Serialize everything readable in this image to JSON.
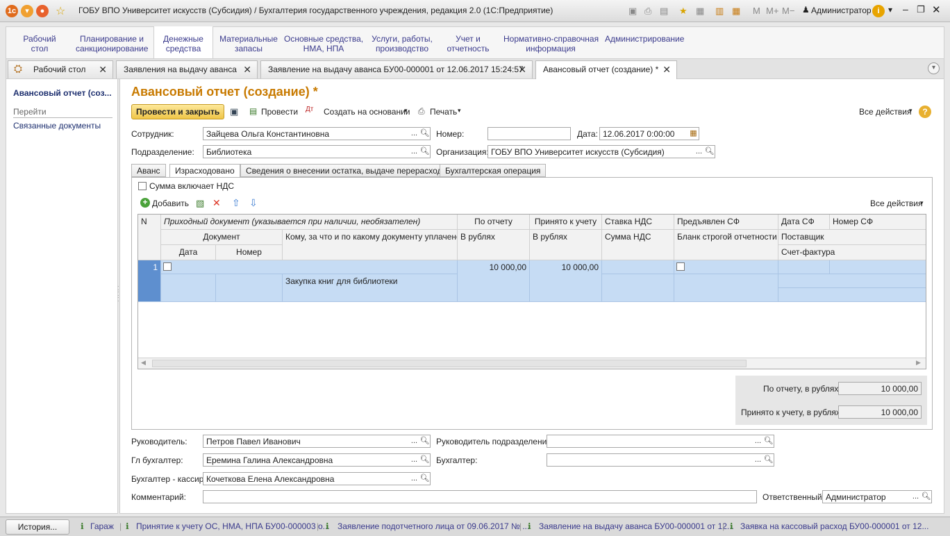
{
  "window": {
    "title": "ГОБУ ВПО Университет искусств (Субсидия) / Бухгалтерия государственного учреждения, редакция 2.0  (1С:Предприятие)",
    "memory_labels": [
      "M",
      "M+",
      "M−"
    ],
    "user": "Администратор"
  },
  "sections": [
    {
      "label": "Рабочий\nстол"
    },
    {
      "label": "Планирование и\nсанкционирование"
    },
    {
      "label": "Денежные\nсредства"
    },
    {
      "label": "Материальные\nзапасы"
    },
    {
      "label": "Основные средства,\nНМА, НПА"
    },
    {
      "label": "Услуги, работы,\nпроизводство"
    },
    {
      "label": "Учет и\nотчетность"
    },
    {
      "label": "Нормативно-справочная\nинформация"
    },
    {
      "label": "Администрирование"
    }
  ],
  "open_tabs": [
    {
      "label": "Рабочий стол"
    },
    {
      "label": "Заявления на выдачу аванса"
    },
    {
      "label": "Заявление на выдачу аванса БУ00-000001 от 12.06.2017 15:24:57"
    },
    {
      "label": "Авансовый отчет (создание) *"
    }
  ],
  "leftnav": {
    "current": "Авансовый отчет (соз...",
    "goto_header": "Перейти",
    "links": [
      "Связанные документы"
    ]
  },
  "form": {
    "title": "Авансовый отчет (создание) *",
    "toolbar": {
      "post_close": "Провести и закрыть",
      "post": "Провести",
      "create_based": "Создать на основании",
      "print": "Печать",
      "all_actions": "Все действия"
    },
    "employee_label": "Сотрудник:",
    "employee": "Зайцева Ольга Константиновна",
    "number_label": "Номер:",
    "number": "",
    "date_label": "Дата:",
    "date": "12.06.2017  0:00:00",
    "department_label": "Подразделение:",
    "department": "Библиотека",
    "org_label": "Организация:",
    "org": "ГОБУ ВПО Университет искусств (Субсидия)",
    "tabs": [
      "Аванс",
      "Израсходовано",
      "Сведения о внесении остатка, выдаче перерасхода",
      "Бухгалтерская операция"
    ],
    "vat_checkbox": "Сумма включает НДС",
    "add_button": "Добавить",
    "grid_all_actions": "Все действия",
    "grid_headers": {
      "n": "N",
      "incoming_doc": "Приходный документ (указывается при наличии, необязателен)",
      "document": "Документ",
      "date": "Дата",
      "number": "Номер",
      "to_whom": "Кому, за что и по какому документу уплачено",
      "by_report": "По отчету",
      "by_report_sub": "В рублях",
      "accepted": "Принято к учету",
      "accepted_sub": "В рублях",
      "vat_rate": "Ставка НДС",
      "vat_sum": "Сумма НДС",
      "sf_presented": "Предъявлен СФ",
      "strict_form": "Бланк строгой отчетности",
      "sf_date": "Дата СФ",
      "sf_number": "Номер СФ",
      "supplier": "Поставщик",
      "invoice": "Счет-фактура"
    },
    "rows": [
      {
        "n": "1",
        "description": "Закупка книг для библиотеки",
        "by_report": "10 000,00",
        "accepted": "10 000,00"
      }
    ],
    "totals": {
      "by_report_label": "По отчету, в рублях:",
      "by_report": "10 000,00",
      "accepted_label": "Принято к учету, в рублях:",
      "accepted": "10 000,00"
    },
    "head_label": "Руководитель:",
    "head": "Петров Павел Иванович",
    "dept_head_label": "Руководитель подразделения:",
    "dept_head": "",
    "chief_acc_label": "Гл бухгалтер:",
    "chief_acc": "Еремина Галина Александровна",
    "acc_label": "Бухгалтер:",
    "acc": "",
    "cashier_label": "Бухгалтер - кассир:",
    "cashier": "Кочеткова Елена Александровна",
    "comment_label": "Комментарий:",
    "comment": "",
    "responsible_label": "Ответственный:",
    "responsible": "Администратор"
  },
  "taskbar": {
    "history": "История...",
    "items": [
      "Гараж",
      "Принятие к учету ОС, НМА, НПА БУ00-000003 о...",
      "Заявление подотчетного лица от 09.06.2017 № ...",
      "Заявление на выдачу аванса БУ00-000001 от 12...",
      "Заявка на кассовый расход БУ00-000001 от 12..."
    ]
  }
}
